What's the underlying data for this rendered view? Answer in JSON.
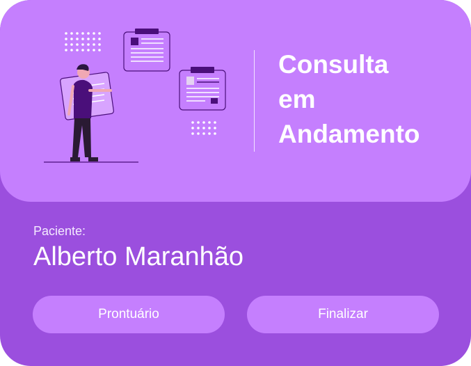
{
  "card": {
    "title_lines": [
      "Consulta",
      "em",
      "Andamento"
    ],
    "patient_label": "Paciente:",
    "patient_name": "Alberto Maranhão"
  },
  "actions": {
    "record_label": "Prontuário",
    "finish_label": "Finalizar"
  },
  "colors": {
    "card_bg": "#9b4fde",
    "hero_bg": "#c57ffe",
    "button_bg": "#c57ffe",
    "illustration_dark": "#4a0f7a"
  },
  "illustration": "person-with-documents"
}
